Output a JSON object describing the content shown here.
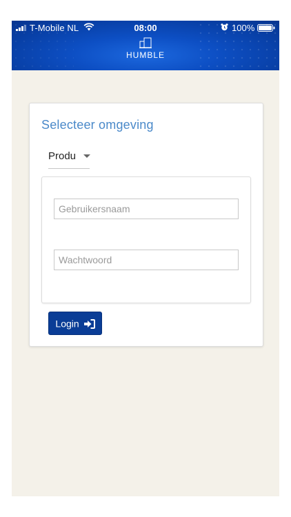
{
  "status_bar": {
    "carrier": "T-Mobile NL",
    "time": "08:00",
    "battery": "100%",
    "icons": [
      "signal-icon",
      "wifi-icon",
      "alarm-icon",
      "battery-icon"
    ]
  },
  "header": {
    "brand": "HUMBLE",
    "logo_icon": "buildings-icon"
  },
  "login": {
    "title": "Selecteer omgeving",
    "environment": {
      "selected": "Produ"
    },
    "username_placeholder": "Gebruikersnaam",
    "username_value": "",
    "password_placeholder": "Wachtwoord",
    "password_value": "",
    "button_label": "Login",
    "button_icon": "sign-in-icon"
  },
  "colors": {
    "header_blue": "#0d4fc4",
    "title_blue": "#4a89c9",
    "button_blue": "#0a3d96",
    "page_background": "#f4f1e9"
  }
}
